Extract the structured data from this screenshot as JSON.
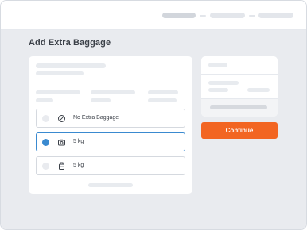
{
  "page": {
    "title": "Add Extra Baggage"
  },
  "options": [
    {
      "label": "No Extra Baggage",
      "icon": "no-baggage-icon",
      "selected": false
    },
    {
      "label": "5 kg",
      "icon": "camera-bag-icon",
      "selected": true
    },
    {
      "label": "5 kg",
      "icon": "suitcase-icon",
      "selected": false
    }
  ],
  "actions": {
    "continue_label": "Continue"
  },
  "colors": {
    "accent": "#3a8ad0",
    "cta": "#f26522",
    "background": "#e9ebef"
  }
}
